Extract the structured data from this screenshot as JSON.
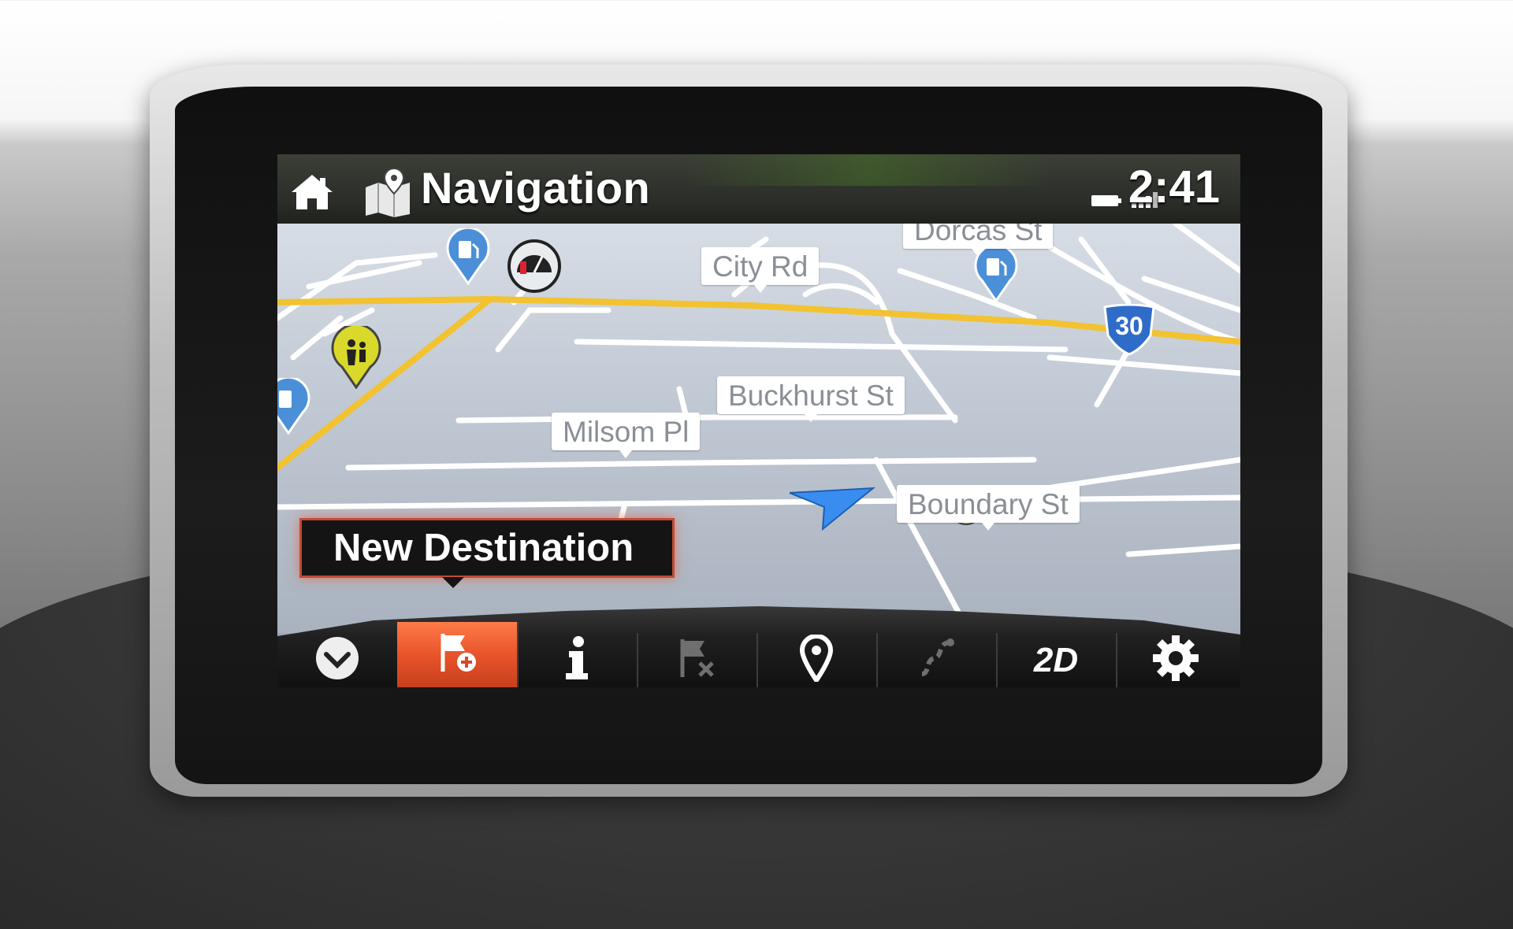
{
  "header": {
    "title": "Navigation",
    "time": "2:41"
  },
  "map": {
    "road_labels": [
      "Dorcas St",
      "City Rd",
      "Buckhurst St",
      "Milsom Pl",
      "Boundary St"
    ],
    "highway_shield": "30"
  },
  "tooltip": {
    "text": "New Destination"
  },
  "toolbar": {
    "buttons": [
      {
        "id": "collapse",
        "icon": "chevron-down-icon",
        "active": false
      },
      {
        "id": "new-destination",
        "icon": "flag-plus-icon",
        "active": true
      },
      {
        "id": "info",
        "icon": "info-icon",
        "active": false
      },
      {
        "id": "cancel-route",
        "icon": "flag-x-icon",
        "active": false
      },
      {
        "id": "location",
        "icon": "location-pin-icon",
        "active": false
      },
      {
        "id": "route",
        "icon": "route-icon",
        "active": false
      },
      {
        "id": "view-mode",
        "icon": "2d-view-icon",
        "label": "2D",
        "active": false
      },
      {
        "id": "settings",
        "icon": "gear-icon",
        "active": false
      }
    ]
  },
  "colors": {
    "accent": "#e8542b",
    "map_bg": "#c2cad5",
    "road_major": "#f2c230",
    "poi_blue": "#4a8fd8",
    "school_yellow": "#d8d92a"
  }
}
